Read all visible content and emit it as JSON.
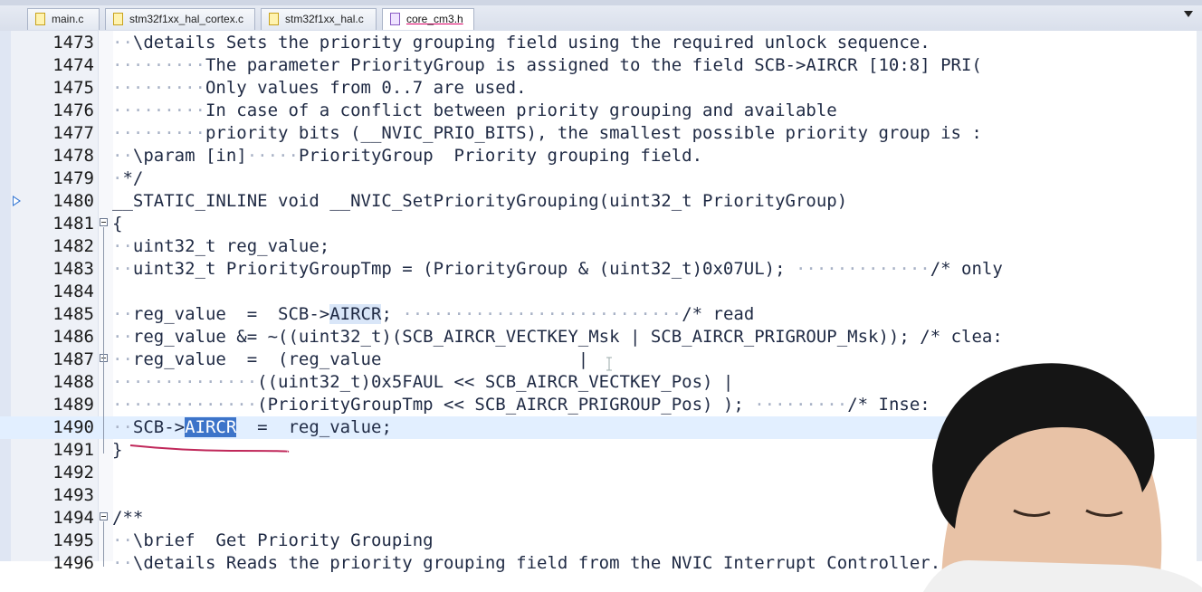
{
  "tabs": [
    {
      "label": "main.c",
      "active": false
    },
    {
      "label": "stm32f1xx_hal_cortex.c",
      "active": false
    },
    {
      "label": "stm32f1xx_hal.c",
      "active": false
    },
    {
      "label": "core_cm3.h",
      "active": true
    }
  ],
  "colors": {
    "selection": "#3d74c9",
    "current_line": "#e2efff",
    "annotation_underline": "#c0285a"
  },
  "editor": {
    "lines": [
      {
        "n": "1473",
        "segs": [
          {
            "t": "··",
            "c": "d"
          },
          {
            "t": "\\details Sets the priority grouping field using the required unlock sequence."
          }
        ]
      },
      {
        "n": "1474",
        "segs": [
          {
            "t": "·········",
            "c": "d"
          },
          {
            "t": "The parameter PriorityGroup is assigned to the field SCB->AIRCR [10:8] PRI("
          }
        ]
      },
      {
        "n": "1475",
        "segs": [
          {
            "t": "·········",
            "c": "d"
          },
          {
            "t": "Only values from 0..7 are used."
          }
        ]
      },
      {
        "n": "1476",
        "segs": [
          {
            "t": "·········",
            "c": "d"
          },
          {
            "t": "In case of a conflict between priority grouping and available"
          }
        ]
      },
      {
        "n": "1477",
        "segs": [
          {
            "t": "·········",
            "c": "d"
          },
          {
            "t": "priority bits (__NVIC_PRIO_BITS), the smallest possible priority group is :"
          }
        ]
      },
      {
        "n": "1478",
        "segs": [
          {
            "t": "··",
            "c": "d"
          },
          {
            "t": "\\param [in]"
          },
          {
            "t": "·····",
            "c": "d"
          },
          {
            "t": "PriorityGroup  Priority grouping field."
          }
        ]
      },
      {
        "n": "1479",
        "segs": [
          {
            "t": "·",
            "c": "d"
          },
          {
            "t": "*/"
          }
        ]
      },
      {
        "n": "1480",
        "segs": [
          {
            "t": "__STATIC_INLINE void __NVIC_SetPriorityGrouping(uint32_t PriorityGroup)"
          }
        ]
      },
      {
        "n": "1481",
        "segs": [
          {
            "t": "{"
          }
        ]
      },
      {
        "n": "1482",
        "segs": [
          {
            "t": "··",
            "c": "d"
          },
          {
            "t": "uint32_t reg_value;"
          }
        ]
      },
      {
        "n": "1483",
        "segs": [
          {
            "t": "··",
            "c": "d"
          },
          {
            "t": "uint32_t PriorityGroupTmp = (PriorityGroup & (uint32_t)0x07UL); "
          },
          {
            "t": "·············",
            "c": "d"
          },
          {
            "t": "/* only"
          }
        ]
      },
      {
        "n": "1484",
        "segs": []
      },
      {
        "n": "1485",
        "segs": [
          {
            "t": "··",
            "c": "d"
          },
          {
            "t": "reg_value  =  SCB->"
          },
          {
            "t": "AIRCR",
            "c": "tk"
          },
          {
            "t": "; "
          },
          {
            "t": "···························",
            "c": "d"
          },
          {
            "t": "/* read"
          }
        ]
      },
      {
        "n": "1486",
        "segs": [
          {
            "t": "··",
            "c": "d"
          },
          {
            "t": "reg_value &= ~((uint32_t)(SCB_AIRCR_VECTKEY_Msk | SCB_AIRCR_PRIGROUP_Msk)); /* clea:"
          }
        ]
      },
      {
        "n": "1487",
        "segs": [
          {
            "t": "··",
            "c": "d"
          },
          {
            "t": "reg_value  =  (reg_value"
          },
          {
            "t": "                   ",
            "c": "d"
          },
          {
            "t": "|"
          }
        ]
      },
      {
        "n": "1488",
        "segs": [
          {
            "t": "··············",
            "c": "d"
          },
          {
            "t": "((uint32_t)0x5FAUL << SCB_AIRCR_VECTKEY_Pos) |"
          }
        ]
      },
      {
        "n": "1489",
        "segs": [
          {
            "t": "··············",
            "c": "d"
          },
          {
            "t": "(PriorityGroupTmp << SCB_AIRCR_PRIGROUP_Pos) ); "
          },
          {
            "t": "·········",
            "c": "d"
          },
          {
            "t": "/* Inse:"
          }
        ]
      },
      {
        "n": "1490",
        "segs": [
          {
            "t": "··",
            "c": "d"
          },
          {
            "t": "SCB->"
          },
          {
            "t": "AIRCR",
            "c": "sel"
          },
          {
            "t": "  =  reg_value;"
          }
        ]
      },
      {
        "n": "1491",
        "segs": [
          {
            "t": "}"
          }
        ]
      },
      {
        "n": "1492",
        "segs": []
      },
      {
        "n": "1493",
        "segs": []
      },
      {
        "n": "1494",
        "segs": [
          {
            "t": "/**"
          }
        ]
      },
      {
        "n": "1495",
        "segs": [
          {
            "t": "··",
            "c": "d"
          },
          {
            "t": "\\brief  Get Priority Grouping"
          }
        ]
      },
      {
        "n": "1496",
        "segs": [
          {
            "t": "··",
            "c": "d"
          },
          {
            "t": "\\details Reads the priority grouping field from the NVIC Interrupt Controller."
          }
        ]
      }
    ]
  }
}
